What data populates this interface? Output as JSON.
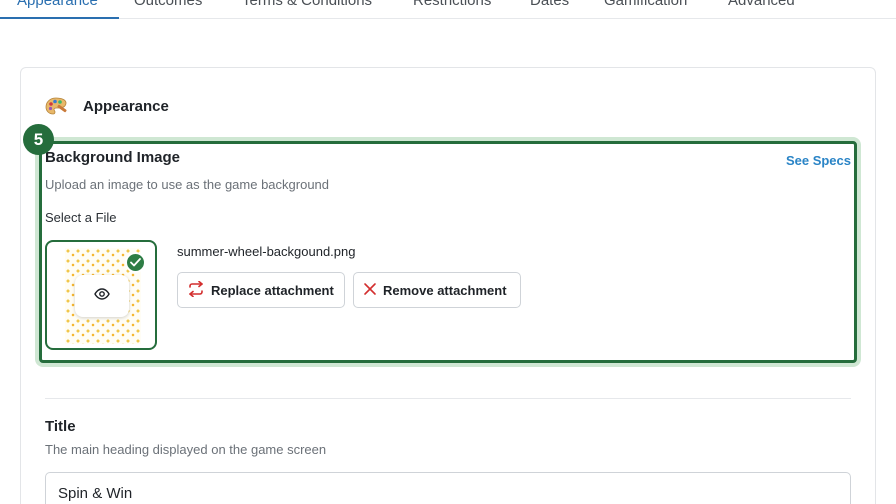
{
  "tabs": [
    {
      "label": "Appearance",
      "active": true
    },
    {
      "label": "Outcomes"
    },
    {
      "label": "Terms & Conditions"
    },
    {
      "label": "Restrictions"
    },
    {
      "label": "Dates"
    },
    {
      "label": "Gamification"
    },
    {
      "label": "Advanced"
    }
  ],
  "section": {
    "title": "Appearance",
    "icon": "palette-icon"
  },
  "step_badge": "5",
  "background_image": {
    "title": "Background Image",
    "see_specs": "See Specs",
    "description": "Upload an image to use as the game background",
    "select_label": "Select a File",
    "filename": "summer-wheel-backgound.png",
    "replace_label": "Replace attachment",
    "remove_label": "Remove attachment"
  },
  "title_field": {
    "label": "Title",
    "description": "The main heading displayed on the game screen",
    "value": "Spin & Win"
  },
  "colors": {
    "accent_blue": "#2a6fb0",
    "highlight_green": "#256d3c",
    "link_blue": "#2a84c6",
    "remove_red": "#d32f2f"
  }
}
